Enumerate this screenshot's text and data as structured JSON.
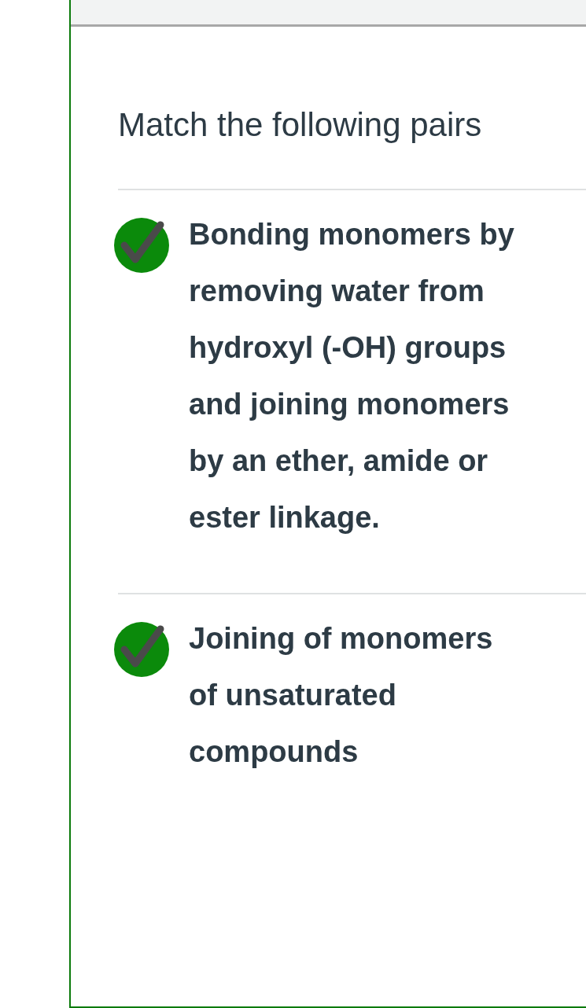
{
  "question": {
    "prompt": "Match the following pairs",
    "items": [
      {
        "text": "Bonding monomers by removing water from hydroxyl (-OH) groups and joining monomers by an ether, amide or ester linkage.",
        "correct": true
      },
      {
        "text": "Joining of monomers of unsaturated compounds",
        "correct": true
      }
    ]
  }
}
